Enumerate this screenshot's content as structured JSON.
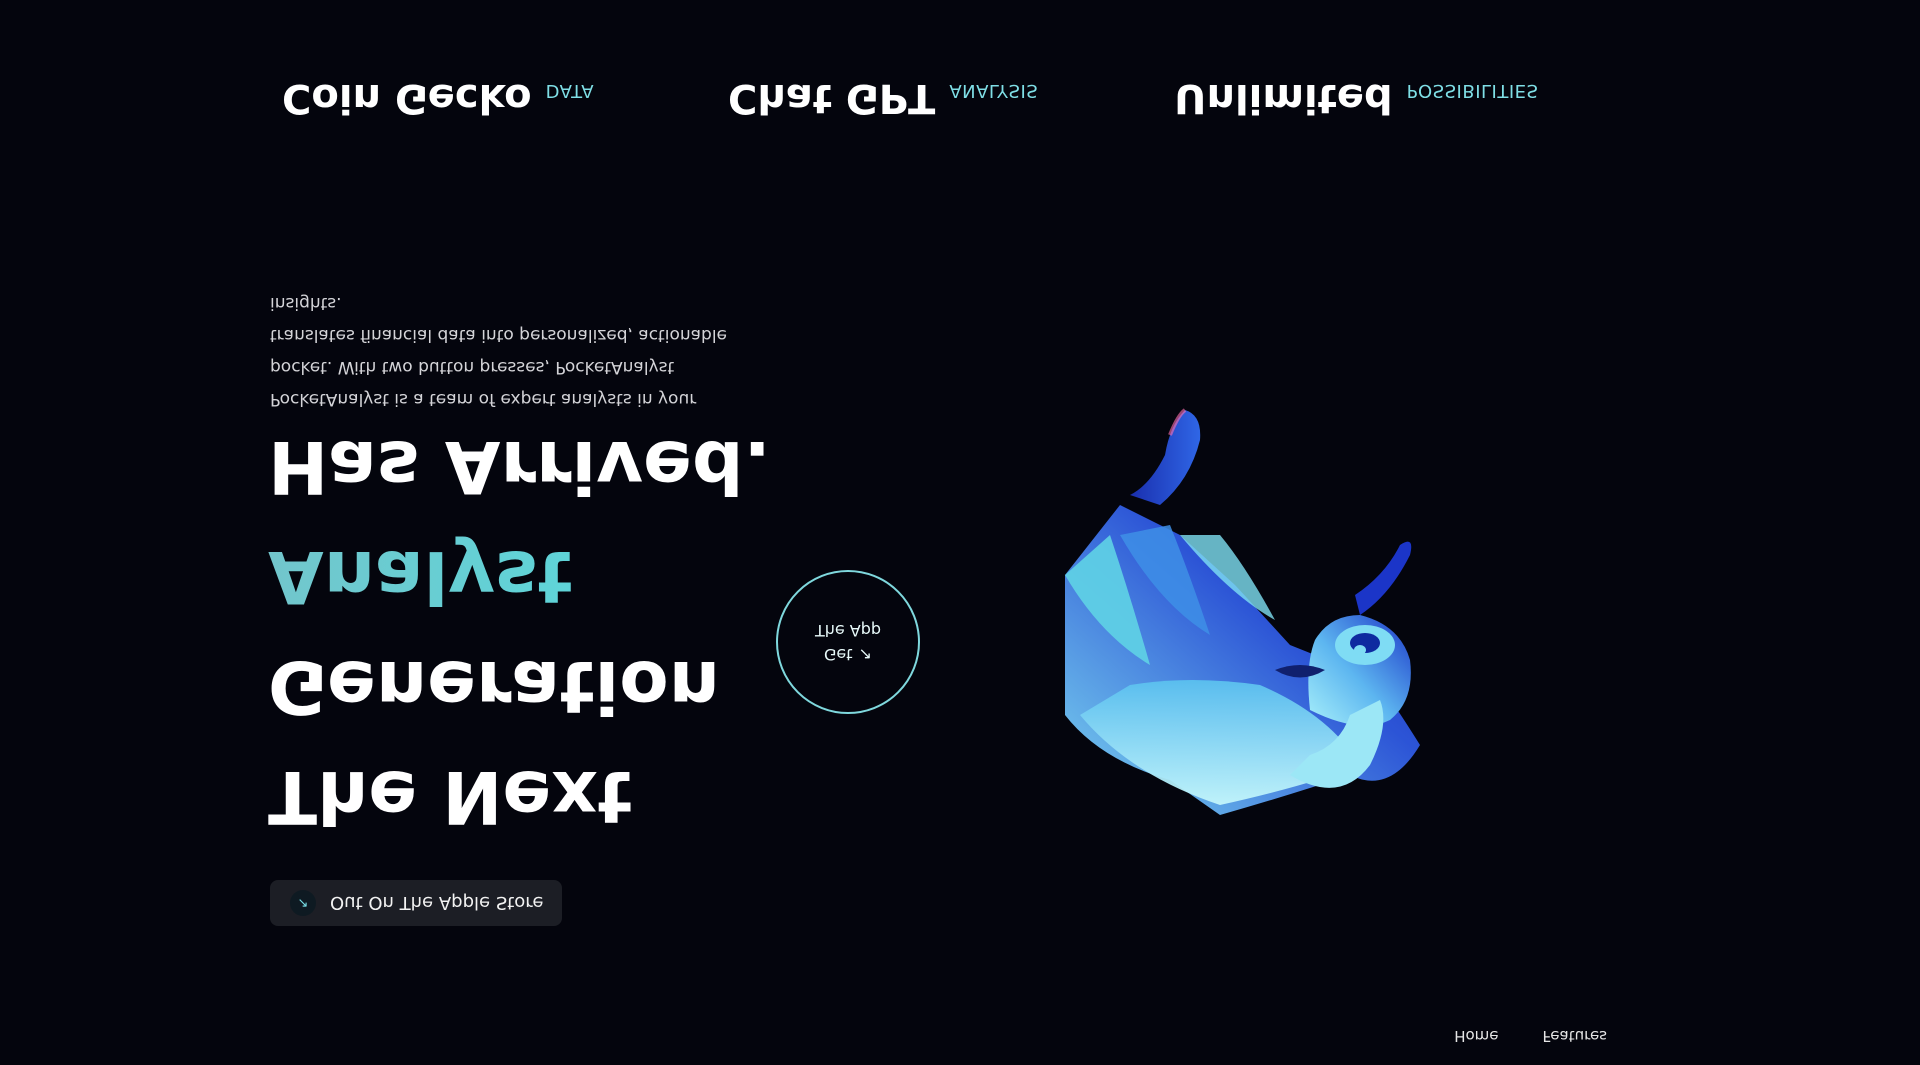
{
  "nav": {
    "home": "Home",
    "features": "Features"
  },
  "store": {
    "icon": "arrow-icon",
    "label": "Out On The Apple Store"
  },
  "hero": {
    "line1": "The Next",
    "line2": "Generation",
    "line3": "Analyst",
    "line4": "Has Arrived.",
    "description": "PocketAnalyst is a team of expert analysts in your pocket. With two button presses, PocketAnalyst translates financial data into personalized, actionable insights."
  },
  "cta": {
    "get": "Get",
    "the_app": "The App",
    "icon": "arrow-up-right-icon"
  },
  "features": [
    {
      "title": "Coin Gecko",
      "tag": "DATA"
    },
    {
      "title": "Chat GPT",
      "tag": "ANALYSIS"
    },
    {
      "title": "Unlimited",
      "tag": "POSSIBILITIES"
    }
  ],
  "colors": {
    "background": "#04050d",
    "accent": "#72d6dc",
    "bull_dark": "#1c39c9",
    "bull_light": "#9fe9f5"
  }
}
